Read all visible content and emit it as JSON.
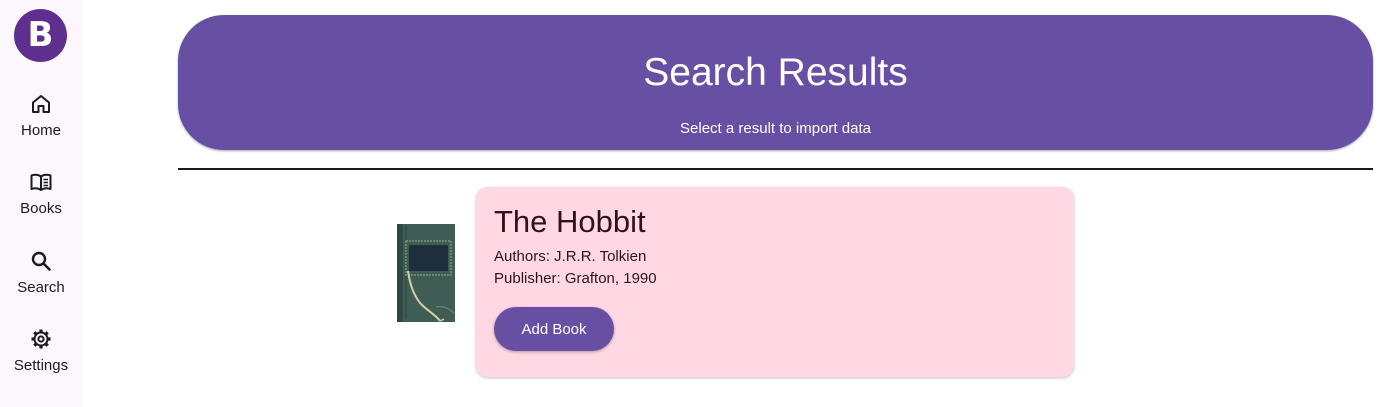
{
  "sidebar": {
    "logo_letter": "B",
    "items": [
      {
        "label": "Home",
        "icon": "home-icon"
      },
      {
        "label": "Books",
        "icon": "book-open-icon"
      },
      {
        "label": "Search",
        "icon": "search-icon"
      },
      {
        "label": "Settings",
        "icon": "gear-icon"
      }
    ]
  },
  "header": {
    "title": "Search Results",
    "subtitle": "Select a result to import data"
  },
  "result": {
    "title": "The Hobbit",
    "authors": "Authors: J.R.R. Tolkien",
    "publisher": "Publisher: Grafton, 1990",
    "button_label": "Add Book",
    "cover_icon": "book-cover-image"
  },
  "colors": {
    "primary": "#6750a4",
    "logo": "#5f2f8f",
    "card": "#ffd8e4",
    "sidebar": "#fcf7fc"
  }
}
